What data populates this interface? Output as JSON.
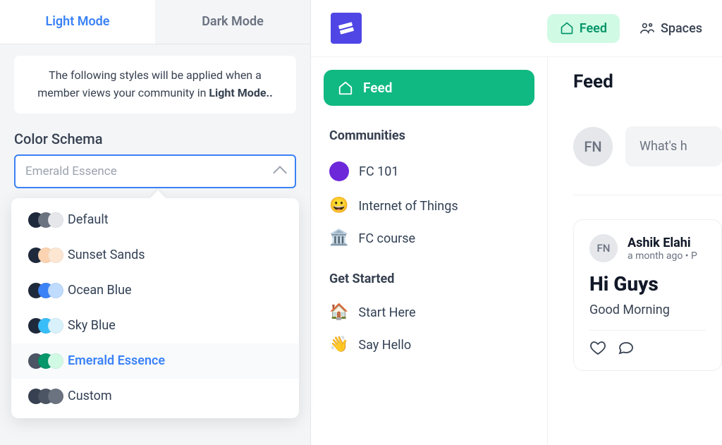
{
  "tabs": {
    "light": "Light Mode",
    "dark": "Dark Mode"
  },
  "intro": {
    "lead": "The following styles will be applied when a member views your community in ",
    "strong": "Light Mode.."
  },
  "color_schema": {
    "label": "Color Schema",
    "selected": "Emerald Essence",
    "options": [
      {
        "label": "Default",
        "colors": [
          "#1e293b",
          "#6b7280",
          "#e5e7eb"
        ]
      },
      {
        "label": "Sunset Sands",
        "colors": [
          "#1e293b",
          "#fcd3b1",
          "#fde7d3"
        ]
      },
      {
        "label": "Ocean Blue",
        "colors": [
          "#1e293b",
          "#3b82f6",
          "#bfdbfe"
        ]
      },
      {
        "label": "Sky Blue",
        "colors": [
          "#1e293b",
          "#38bdf8",
          "#d9f1fb"
        ]
      },
      {
        "label": "Emerald Essence",
        "colors": [
          "#4b5563",
          "#059669",
          "#d1fae5"
        ]
      },
      {
        "label": "Custom",
        "colors": [
          "#374151",
          "#4b5563",
          "#6b7280"
        ]
      }
    ]
  },
  "header": {
    "feed": "Feed",
    "spaces": "Spaces"
  },
  "sidebar": {
    "feed": "Feed",
    "communities_heading": "Communities",
    "communities": [
      {
        "label": "FC 101",
        "type": "dot",
        "color": "#6d28d9"
      },
      {
        "label": "Internet of Things",
        "type": "emoji",
        "emoji": "😀"
      },
      {
        "label": "FC course",
        "type": "emoji",
        "emoji": "🏛️"
      }
    ],
    "get_started_heading": "Get Started",
    "get_started": [
      {
        "label": "Start Here",
        "emoji": "🏠"
      },
      {
        "label": "Say Hello",
        "emoji": "👋"
      }
    ]
  },
  "feed": {
    "title": "Feed",
    "avatar_initials": "FN",
    "composer_placeholder": "What's h",
    "post": {
      "author": "Ashik Elahi",
      "avatar_initials": "FN",
      "meta": "a month ago • P",
      "title": "Hi Guys",
      "body": "Good Morning"
    }
  }
}
